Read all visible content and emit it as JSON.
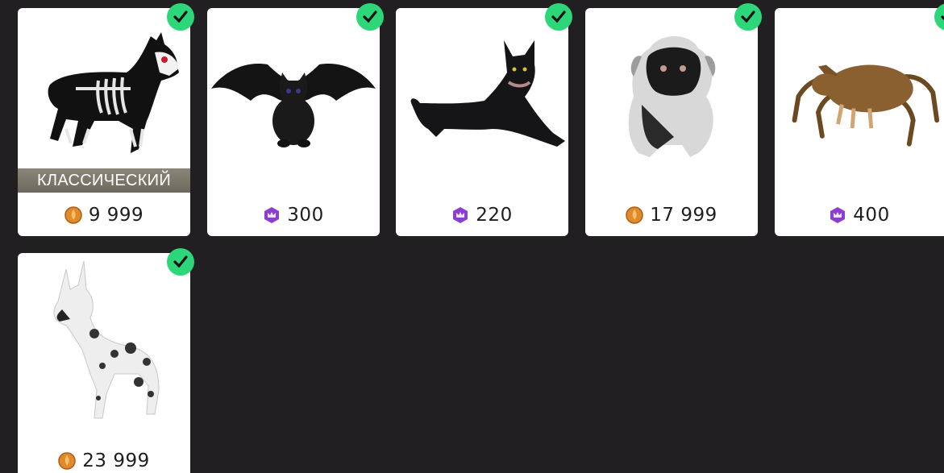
{
  "items": [
    {
      "name": "Skeleton wolf",
      "price": "9 999",
      "currency": "gold-coin-icon",
      "badge": "КЛАССИЧЕСКИЙ",
      "owned": true
    },
    {
      "name": "Bat cat",
      "price": "300",
      "currency": "crown-gem-icon",
      "badge": "",
      "owned": true
    },
    {
      "name": "Black cat",
      "price": "220",
      "currency": "crown-gem-icon",
      "badge": "",
      "owned": true
    },
    {
      "name": "Pug",
      "price": "17 999",
      "currency": "gold-coin-icon",
      "badge": "",
      "owned": true
    },
    {
      "name": "Spider dog",
      "price": "400",
      "currency": "crown-gem-icon",
      "badge": "",
      "owned": true
    },
    {
      "name": "Great Dane",
      "price": "23 999",
      "currency": "gold-coin-icon",
      "badge": "",
      "owned": true
    }
  ],
  "colors": {
    "background": "#211f21",
    "card": "#ffffff",
    "check": "#2ed67a",
    "gold": "#e08a2e",
    "gem": "#8b3fd1"
  }
}
